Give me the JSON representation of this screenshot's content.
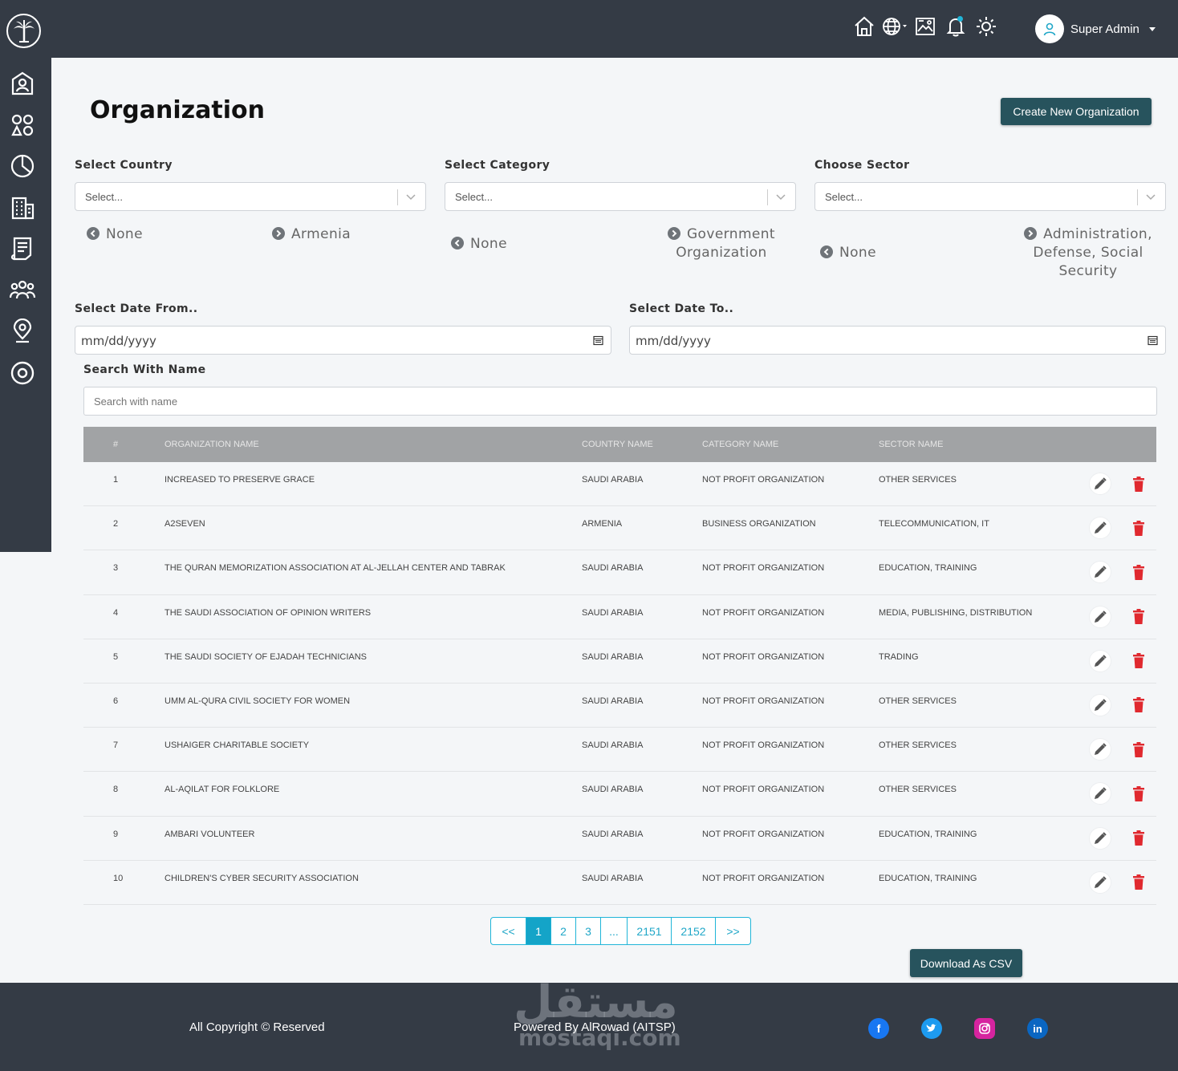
{
  "header": {
    "user_name": "Super Admin",
    "icons": [
      "home-icon",
      "globe-icon",
      "image-icon",
      "bell-icon",
      "sun-icon"
    ]
  },
  "sidebar": {
    "icons": [
      "user-card-icon",
      "apps-icon",
      "pie-chart-icon",
      "building-icon",
      "document-icon",
      "users-icon",
      "location-icon",
      "target-icon"
    ]
  },
  "page": {
    "title": "Organization",
    "create_button": "Create New Organization"
  },
  "filters": {
    "country": {
      "label": "Select Country",
      "placeholder": "Select...",
      "options": [
        "None",
        "Armenia"
      ]
    },
    "category": {
      "label": "Select Category",
      "placeholder": "Select...",
      "options": [
        "None",
        "Government Organization"
      ]
    },
    "sector": {
      "label": "Choose Sector",
      "placeholder": "Select...",
      "options": [
        "None",
        "Administration, Defense, Social Security"
      ]
    },
    "date_from": {
      "label": "Select Date From..",
      "value": "mm/dd/yyyy"
    },
    "date_to": {
      "label": "Select Date To..",
      "value": "mm/dd/yyyy"
    },
    "search": {
      "label": "Search With Name",
      "placeholder": "Search with name"
    }
  },
  "table": {
    "headers": [
      "#",
      "Organization Name",
      "Country Name",
      "Category Name",
      "Sector Name"
    ],
    "rows": [
      {
        "n": "1",
        "name": "Increased to Preserve Grace",
        "country": "Saudi Arabia",
        "category": "Not Profit Organization",
        "sector": "Other Services"
      },
      {
        "n": "2",
        "name": "A2SEVEN",
        "country": "Armenia",
        "category": "Business Organization",
        "sector": "Telecommunication, IT"
      },
      {
        "n": "3",
        "name": "The Quran Memorization Association at Al-Jellah Center and Tabrak",
        "country": "Saudi Arabia",
        "category": "Not Profit Organization",
        "sector": "Education, Training"
      },
      {
        "n": "4",
        "name": "The Saudi Association of Opinion Writers",
        "country": "Saudi Arabia",
        "category": "Not Profit Organization",
        "sector": "Media, Publishing, Distribution"
      },
      {
        "n": "5",
        "name": "The Saudi Society of Ejadah Technicians",
        "country": "Saudi Arabia",
        "category": "Not Profit Organization",
        "sector": "Trading"
      },
      {
        "n": "6",
        "name": "Umm Al-Qura Civil Society for Women",
        "country": "Saudi Arabia",
        "category": "Not Profit Organization",
        "sector": "Other Services"
      },
      {
        "n": "7",
        "name": "Ushaiger Charitable Society",
        "country": "Saudi Arabia",
        "category": "Not Profit Organization",
        "sector": "Other Services"
      },
      {
        "n": "8",
        "name": "Al-Aqilat for Folklore",
        "country": "Saudi Arabia",
        "category": "Not Profit Organization",
        "sector": "Other Services"
      },
      {
        "n": "9",
        "name": "Ambari Volunteer",
        "country": "Saudi Arabia",
        "category": "Not Profit Organization",
        "sector": "Education, Training"
      },
      {
        "n": "10",
        "name": "Children's Cyber Security Association",
        "country": "Saudi Arabia",
        "category": "Not Profit Organization",
        "sector": "Education, Training"
      }
    ]
  },
  "pagination": {
    "pages": [
      "<<",
      "1",
      "2",
      "3",
      "...",
      "2151",
      "2152",
      ">>"
    ],
    "active": "1"
  },
  "download_button": "Download As CSV",
  "footer": {
    "copyright": "All Copyright © Reserved",
    "powered": "Powered By AlRowad (AITSP)",
    "watermark_ar": "مستقل",
    "watermark_en": "mostaqi.com",
    "social": [
      "facebook-icon",
      "twitter-icon",
      "instagram-icon",
      "linkedin-icon"
    ]
  },
  "colors": {
    "dark": "#343b45",
    "accent_button": "#27535d",
    "pager_accent": "#20b5d8",
    "delete": "#e0292f"
  }
}
